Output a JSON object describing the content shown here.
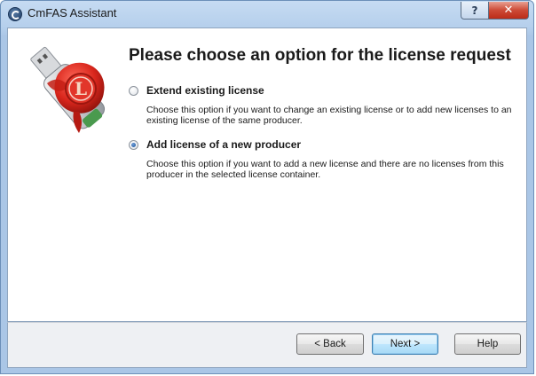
{
  "window": {
    "title": "CmFAS Assistant",
    "help_glyph": "?",
    "close_glyph": "✕"
  },
  "main": {
    "heading": "Please choose an option for the license request",
    "options": [
      {
        "label": "Extend existing license",
        "description": "Choose this option if you want to change an existing license or to add new licenses to an existing license of the same producer.",
        "selected": false
      },
      {
        "label": "Add license of a new producer",
        "description": "Choose this option if you want to add a new license and there are no licenses from this producer in the selected license container.",
        "selected": true
      }
    ]
  },
  "buttons": {
    "back": "< Back",
    "next": "Next >",
    "help": "Help"
  },
  "colors": {
    "accent": "#3c7fb1",
    "close": "#cd4a36",
    "seal": "#d9261c"
  },
  "icons": {
    "app": "codemeter-icon",
    "logo": "usb-key-wax-seal-icon"
  }
}
